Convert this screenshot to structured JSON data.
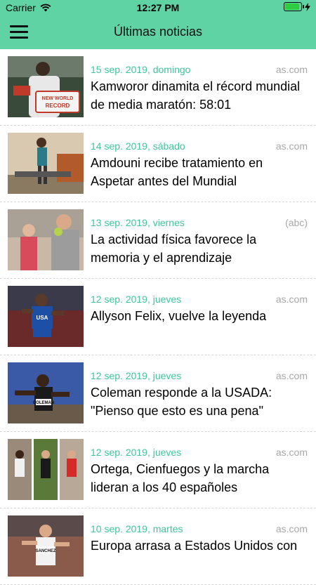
{
  "status": {
    "carrier": "Carrier",
    "time": "12:27 PM",
    "battery_level": 1.0
  },
  "nav": {
    "title": "Últimas noticias",
    "menu_icon": "hamburger-menu-icon"
  },
  "colors": {
    "header": "#5fd3a3",
    "date": "#3fc59a",
    "source": "#a8a8a8"
  },
  "news": [
    {
      "date": "15 sep. 2019, domingo",
      "source": "as.com",
      "headline": "Kamworor dinamita el récord mundial de media maratón: 58:01",
      "thumb_text": "NEW WORLD RECORD"
    },
    {
      "date": "14 sep. 2019, sábado",
      "source": "as.com",
      "headline": "Amdouni recibe tratamiento en Aspetar antes del Mundial"
    },
    {
      "date": "13 sep. 2019, viernes",
      "source": "(abc)",
      "headline": "La actividad física favorece la memoria y el aprendizaje"
    },
    {
      "date": "12 sep. 2019, jueves",
      "source": "as.com",
      "headline": "Allyson Felix, vuelve la leyenda",
      "thumb_text": "USA"
    },
    {
      "date": "12 sep. 2019, jueves",
      "source": "as.com",
      "headline": "Coleman responde a la USADA: \"Pienso que esto es una pena\"",
      "thumb_text": "COLEMAN"
    },
    {
      "date": "12 sep. 2019, jueves",
      "source": "as.com",
      "headline": "Ortega, Cienfuegos y la marcha lideran a los 40 españoles"
    },
    {
      "date": "10 sep. 2019, martes",
      "source": "as.com",
      "headline": "Europa arrasa a Estados Unidos con",
      "thumb_text": "SANCHEZ"
    }
  ]
}
